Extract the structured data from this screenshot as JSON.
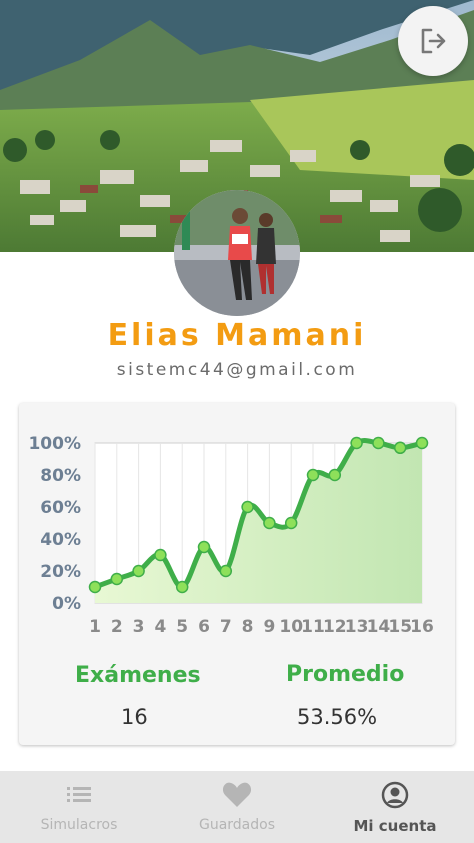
{
  "profile": {
    "name": "Elias Mamani",
    "email": "sistemc44@gmail.com"
  },
  "stats": {
    "exams_label": "Exámenes",
    "exams_value": "16",
    "average_label": "Promedio",
    "average_value": "53.56%"
  },
  "chart_data": {
    "type": "area",
    "x": [
      1,
      2,
      3,
      4,
      5,
      6,
      7,
      8,
      9,
      10,
      11,
      12,
      13,
      14,
      15,
      16
    ],
    "x_tick_labels": [
      "1",
      "2",
      "3",
      "4",
      "5",
      "6",
      "7",
      "8",
      "9",
      "10",
      "11",
      "12",
      "13",
      "14",
      "15",
      "16"
    ],
    "series": [
      {
        "values": [
          10,
          15,
          20,
          30,
          10,
          35,
          20,
          60,
          50,
          50,
          80,
          80,
          100,
          100,
          97,
          100
        ]
      }
    ],
    "y_tick_labels": [
      "100%",
      "80%",
      "60%",
      "40%",
      "20%",
      "0%"
    ],
    "ylim": [
      0,
      100
    ],
    "grid": true,
    "line_color": "#3fae49",
    "point_color": "#8ee05a"
  },
  "tabs": [
    {
      "label": "Simulacros",
      "icon": "list-icon",
      "active": false
    },
    {
      "label": "Guardados",
      "icon": "heart-icon",
      "active": false
    },
    {
      "label": "Mi cuenta",
      "icon": "user-circle-icon",
      "active": true
    }
  ],
  "colors": {
    "accent": "#f39c12",
    "green": "#3fae49"
  }
}
